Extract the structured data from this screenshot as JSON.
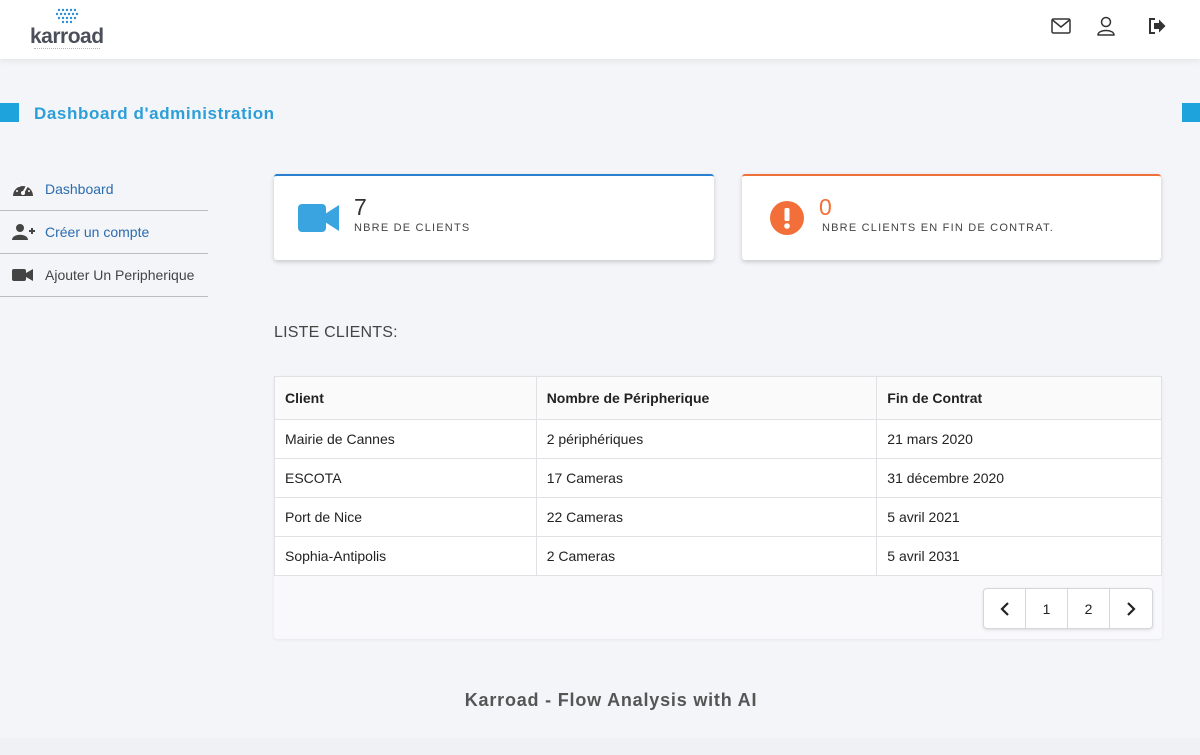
{
  "app": {
    "logo_text": "karroad",
    "brand_color": "#1fa3dc"
  },
  "header_icons": [
    {
      "name": "mail-icon"
    },
    {
      "name": "user-icon"
    },
    {
      "name": "logout-icon"
    }
  ],
  "section": {
    "title": "Dashboard d'administration"
  },
  "sidebar": {
    "items": [
      {
        "label": "Dashboard",
        "icon": "tachometer-icon"
      },
      {
        "label": "Créer un compte",
        "icon": "user-plus-icon"
      },
      {
        "label": "Ajouter Un Peripherique",
        "icon": "video-camera-icon"
      }
    ]
  },
  "stats": {
    "clients": {
      "value": "7",
      "caption": "NBRE DE CLIENTS",
      "icon": "video-camera-icon",
      "color": "#3aa4e0"
    },
    "expiring": {
      "value": "0",
      "caption": "NBRE CLIENTS EN FIN DE CONTRAT.",
      "icon": "exclamation-circle-icon",
      "color": "#f36f3a"
    }
  },
  "clients_list": {
    "title": "LISTE CLIENTS:",
    "columns": [
      "Client",
      "Nombre de Péripherique",
      "Fin de Contrat"
    ],
    "rows": [
      [
        "Mairie de Cannes",
        "2 périphériques",
        "21 mars 2020"
      ],
      [
        "ESCOTA",
        "17 Cameras",
        "31 décembre 2020"
      ],
      [
        "Port de Nice",
        "22 Cameras",
        "5 avril 2021"
      ],
      [
        "Sophia-Antipolis",
        "2 Cameras",
        "5 avril 2031"
      ]
    ]
  },
  "pagination": {
    "prev": "‹",
    "pages": [
      "1",
      "2"
    ],
    "next": "›"
  },
  "footer": {
    "text": "Karroad - Flow Analysis with AI"
  }
}
